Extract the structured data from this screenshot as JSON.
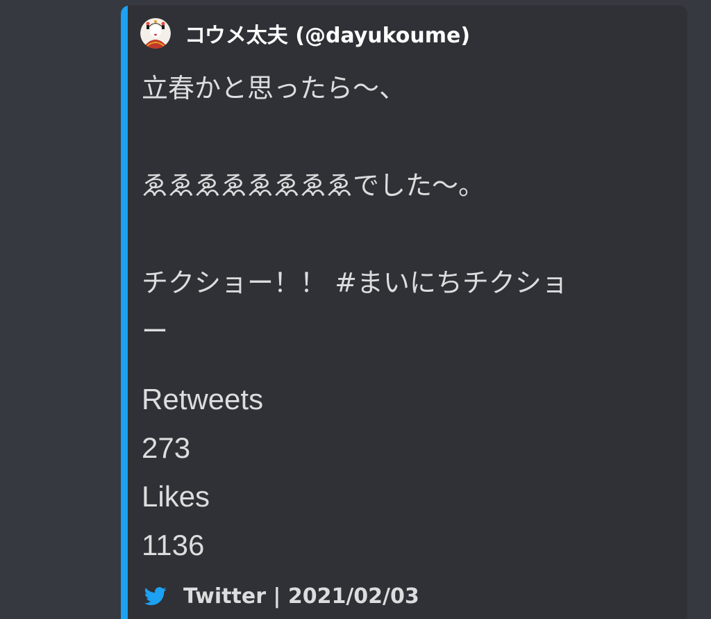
{
  "embed": {
    "accent_color": "#1da1f2",
    "author": {
      "avatar_icon": "avatar-image",
      "name": "コウメ太夫 (@dayukoume)"
    },
    "description": {
      "line1": "立春かと思ったら〜、",
      "line2": "ゑゑゑゑゑゑゑゑでした〜。",
      "line3_text": "チクショー！！ ",
      "line3_hashtag": "#まいにちチクショ",
      "line4": "ー"
    },
    "fields": [
      {
        "name": "Retweets",
        "value": "273"
      },
      {
        "name": "Likes",
        "value": "1136"
      }
    ],
    "footer": {
      "icon": "twitter-bird-icon",
      "text": "Twitter | 2021/02/03"
    }
  }
}
